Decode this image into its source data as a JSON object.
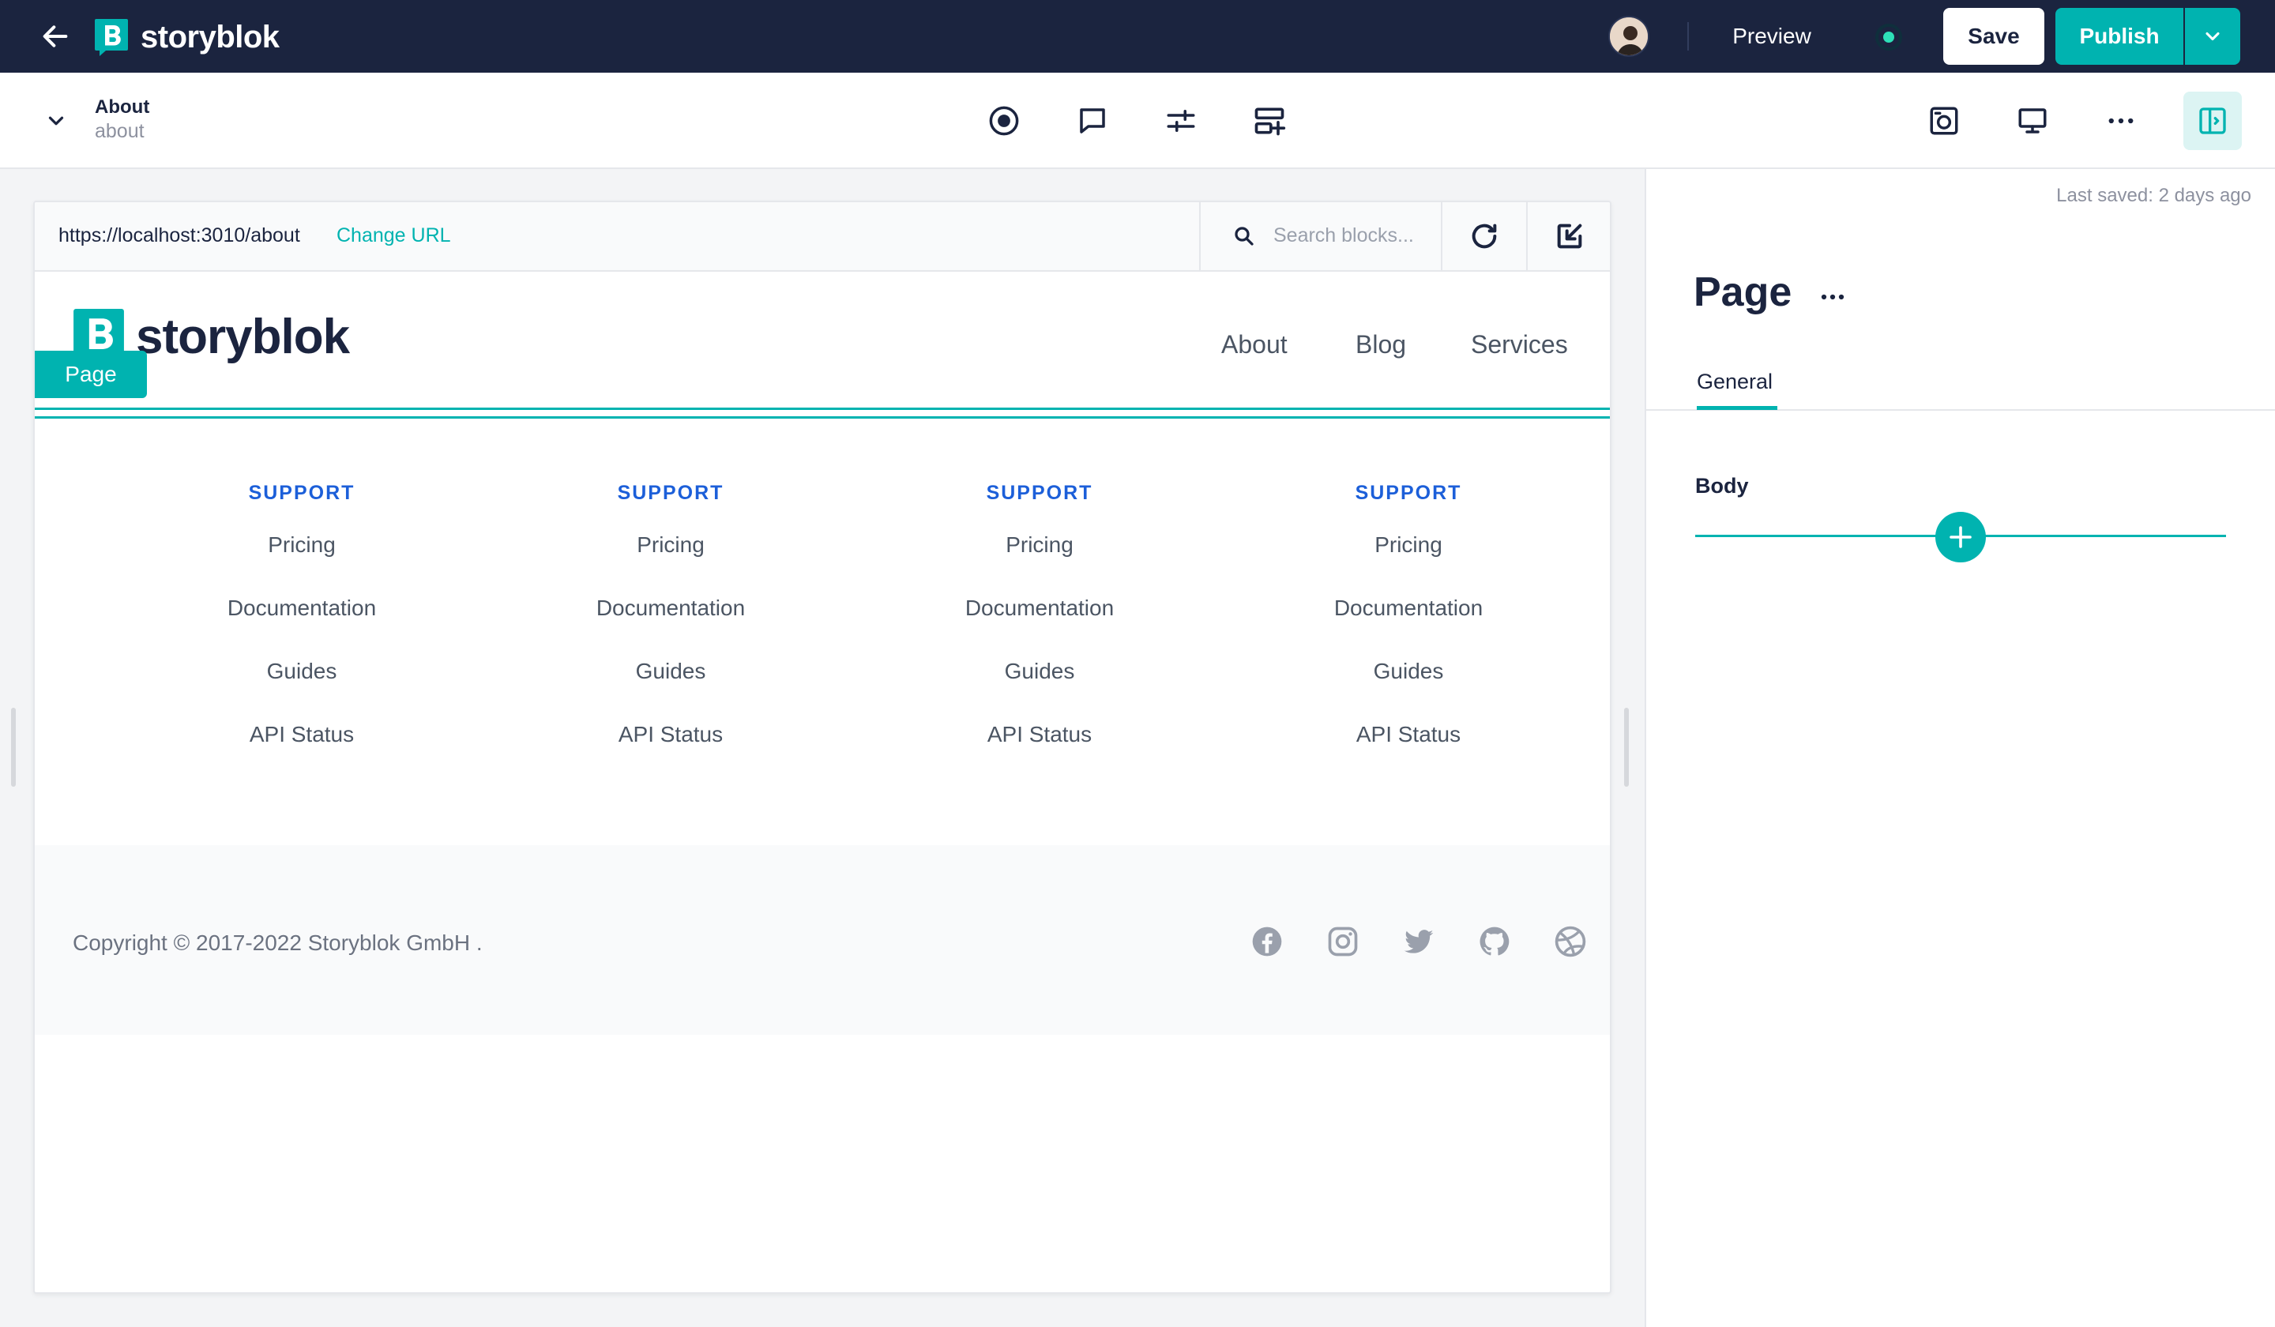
{
  "topbar": {
    "brand_name": "storyblok",
    "preview_label": "Preview",
    "save_label": "Save",
    "publish_label": "Publish"
  },
  "story": {
    "title": "About",
    "slug": "about"
  },
  "preview": {
    "url": "https://localhost:3010/about",
    "change_url_label": "Change URL",
    "search_placeholder": "Search blocks..."
  },
  "site": {
    "logo_text": "storyblok",
    "block_badge": "Page",
    "nav": [
      "About",
      "Blog",
      "Services"
    ],
    "footer_columns": [
      {
        "heading": "SUPPORT",
        "links": [
          "Pricing",
          "Documentation",
          "Guides",
          "API Status"
        ]
      },
      {
        "heading": "SUPPORT",
        "links": [
          "Pricing",
          "Documentation",
          "Guides",
          "API Status"
        ]
      },
      {
        "heading": "SUPPORT",
        "links": [
          "Pricing",
          "Documentation",
          "Guides",
          "API Status"
        ]
      },
      {
        "heading": "SUPPORT",
        "links": [
          "Pricing",
          "Documentation",
          "Guides",
          "API Status"
        ]
      }
    ],
    "copyright": "Copyright © 2017-2022  Storyblok GmbH  .",
    "social_icons": [
      "facebook-icon",
      "instagram-icon",
      "twitter-icon",
      "github-icon",
      "dribbble-icon"
    ]
  },
  "panel": {
    "last_saved": "Last saved: 2 days ago",
    "title": "Page",
    "tab": "General",
    "field_label": "Body"
  },
  "colors": {
    "navy": "#1b243f",
    "teal": "#00b3b0",
    "blue_heading": "#1c5fd9"
  }
}
